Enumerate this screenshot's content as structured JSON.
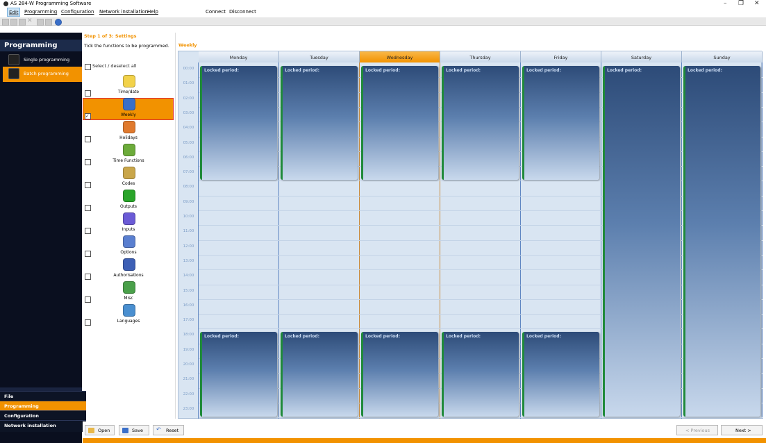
{
  "window": {
    "title": "AS 284-W Programming Software",
    "min": "–",
    "max": "❐",
    "close": "✕"
  },
  "menubar": {
    "items": [
      "Edit",
      "Programming",
      "Configuration",
      "Network installation",
      "Help"
    ],
    "connect": "Connect",
    "disconnect": "Disconnect"
  },
  "nav": {
    "header": "Programming",
    "items": [
      {
        "label": "Single programming",
        "icon": "single-programmer-icon"
      },
      {
        "label": "Batch programming",
        "icon": "batch-programmer-icon",
        "selected": true
      }
    ],
    "bottom": [
      "File",
      "Programming",
      "Configuration",
      "Network installation"
    ]
  },
  "settings": {
    "step_title": "Step 1 of 3: Settings",
    "instruction": "Tick the functions to be programmed.",
    "select_all": "Select / deselect all",
    "functions": [
      {
        "label": "Time/date",
        "icon": "clock-icon",
        "checked": false
      },
      {
        "label": "Weekly",
        "icon": "weekly-calendar-icon",
        "checked": true
      },
      {
        "label": "Holidays",
        "icon": "holidays-calendar-icon",
        "checked": false
      },
      {
        "label": "Time Functions",
        "icon": "time-functions-icon",
        "checked": false
      },
      {
        "label": "Codes",
        "icon": "keys-icon",
        "checked": false
      },
      {
        "label": "Outputs",
        "icon": "arrow-right-icon",
        "checked": false
      },
      {
        "label": "Inputs",
        "icon": "arrow-left-icon",
        "checked": false
      },
      {
        "label": "Options",
        "icon": "options-icon",
        "checked": false
      },
      {
        "label": "Authorisations",
        "icon": "authorisations-icon",
        "checked": false
      },
      {
        "label": "Misc",
        "icon": "misc-icon",
        "checked": false
      },
      {
        "label": "Languages",
        "icon": "globe-icon",
        "checked": false
      }
    ]
  },
  "weekly": {
    "title": "Weekly",
    "days": [
      "Monday",
      "Tuesday",
      "Wednesday",
      "Thursday",
      "Friday",
      "Saturday",
      "Sunday"
    ],
    "active_day": "Wednesday",
    "times": [
      "00:00",
      "01:00",
      "02:00",
      "03:00",
      "04:00",
      "05:00",
      "06:00",
      "07:00",
      "08:00",
      "09:00",
      "10:00",
      "11:00",
      "12:00",
      "13:00",
      "14:00",
      "15:00",
      "16:00",
      "17:00",
      "18:00",
      "19:00",
      "20:00",
      "21:00",
      "22:00",
      "23:00"
    ],
    "locked_label": "Locked period:",
    "locked_periods": [
      {
        "day": "Monday",
        "from": "00:00",
        "to": "08:00"
      },
      {
        "day": "Tuesday",
        "from": "00:00",
        "to": "08:00"
      },
      {
        "day": "Wednesday",
        "from": "00:00",
        "to": "08:00"
      },
      {
        "day": "Thursday",
        "from": "00:00",
        "to": "08:00"
      },
      {
        "day": "Friday",
        "from": "00:00",
        "to": "08:00"
      },
      {
        "day": "Saturday",
        "from": "00:00",
        "to": "24:00"
      },
      {
        "day": "Sunday",
        "from": "00:00",
        "to": "24:00"
      },
      {
        "day": "Monday",
        "from": "18:00",
        "to": "24:00"
      },
      {
        "day": "Tuesday",
        "from": "18:00",
        "to": "24:00"
      },
      {
        "day": "Wednesday",
        "from": "18:00",
        "to": "24:00"
      },
      {
        "day": "Thursday",
        "from": "18:00",
        "to": "24:00"
      },
      {
        "day": "Friday",
        "from": "18:00",
        "to": "24:00"
      }
    ]
  },
  "bottom": {
    "open": "Open",
    "save": "Save",
    "reset": "Reset",
    "previous": "< Previous",
    "next": "Next >"
  },
  "colors": {
    "accent": "#f29200",
    "nav_bg": "#0a0f1f",
    "locked_green": "#1f8a3a"
  }
}
